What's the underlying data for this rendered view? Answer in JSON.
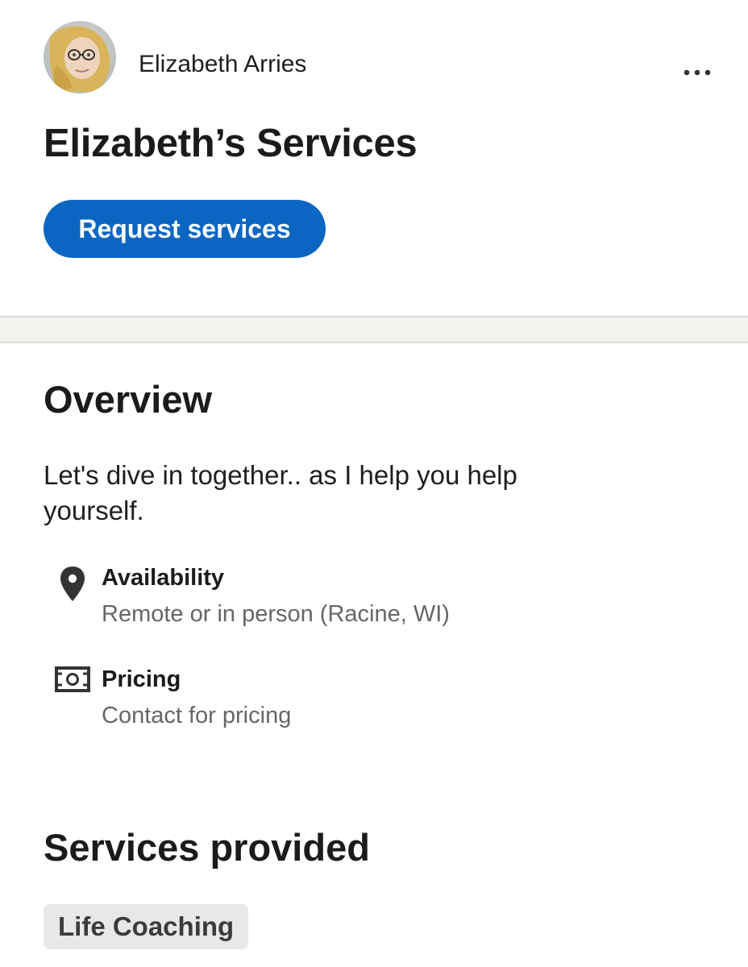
{
  "profile": {
    "name": "Elizabeth Arries",
    "avatar_icon": "user-photo-avatar",
    "more_icon": "more-horizontal-icon"
  },
  "page": {
    "title": "Elizabeth’s Services",
    "request_button_label": "Request services"
  },
  "overview": {
    "title": "Overview",
    "description": "Let's dive in together.. as I help you help yourself.",
    "items": [
      {
        "icon": "location-pin-icon",
        "label": "Availability",
        "value": "Remote or in person (Racine, WI)"
      },
      {
        "icon": "money-bill-icon",
        "label": "Pricing",
        "value": "Contact for pricing"
      }
    ]
  },
  "services": {
    "title": "Services provided",
    "items": [
      "Life Coaching"
    ]
  },
  "colors": {
    "accent": "#0a66c2",
    "divider_band": "#f3f2ef",
    "pill_background": "#e8e8e8",
    "secondary_text": "#666666"
  }
}
